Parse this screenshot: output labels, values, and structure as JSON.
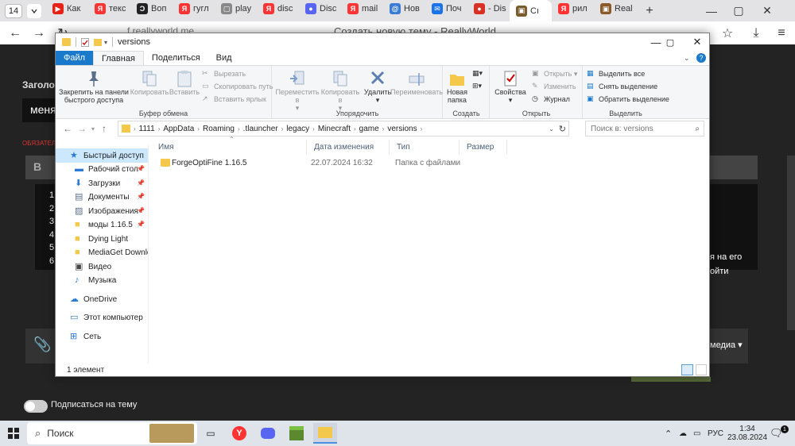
{
  "browser": {
    "tab_count": "14",
    "tabs": [
      {
        "label": "Как",
        "color": "#e62117",
        "glyph": "▶"
      },
      {
        "label": "текс",
        "color": "#f33",
        "glyph": "Я"
      },
      {
        "label": "Воп",
        "color": "#222",
        "glyph": "Ɔ"
      },
      {
        "label": "гугл",
        "color": "#f33",
        "glyph": "Я"
      },
      {
        "label": "play",
        "color": "#888",
        "glyph": "▢"
      },
      {
        "label": "disc",
        "color": "#f33",
        "glyph": "Я"
      },
      {
        "label": "Disc",
        "color": "#5865f2",
        "glyph": "●"
      },
      {
        "label": "mail",
        "color": "#f33",
        "glyph": "Я"
      },
      {
        "label": "Нов",
        "color": "#3a7bd5",
        "glyph": "@"
      },
      {
        "label": "Поч",
        "color": "#1a73e8",
        "glyph": "✉"
      },
      {
        "label": "- Dis",
        "color": "#d93025",
        "glyph": "●"
      },
      {
        "label": "Cı",
        "color": "#7a5c2e",
        "glyph": "▣"
      },
      {
        "label": "рил",
        "color": "#f33",
        "glyph": "Я"
      },
      {
        "label": "Real",
        "color": "#8b5a2b",
        "glyph": "▣"
      }
    ],
    "url": "f.reallyworld.me",
    "page_title": "Создать новую тему - ReallyWorld"
  },
  "webpage": {
    "heading_fragment": "Заголов",
    "input_fragment": "меня",
    "required_fragment": "ОБЯЗАТЕЛ",
    "toolbar_b": "B",
    "list_numbers": [
      "1.",
      "2.",
      "3.",
      "4.",
      "5.",
      "6."
    ],
    "right_text_1": "я на его",
    "right_text_2": "ойти",
    "media_label": "медиа",
    "subscribe_label": "Подписаться на тему"
  },
  "explorer": {
    "title": "versions",
    "ribbon_tabs": [
      "Файл",
      "Главная",
      "Поделиться",
      "Вид"
    ],
    "groups": {
      "clipboard": "Буфер обмена",
      "organize": "Упорядочить",
      "create": "Создать",
      "open": "Открыть",
      "select": "Выделить"
    },
    "buttons": {
      "pin": "Закрепить на панели быстрого доступа",
      "copy": "Копировать",
      "paste": "Вставить",
      "cut": "Вырезать",
      "copy_path": "Скопировать путь",
      "paste_shortcut": "Вставить ярлык",
      "move": "Переместить в",
      "copy_to": "Копировать в",
      "delete": "Удалить",
      "rename": "Переименовать",
      "new_folder": "Новая папка",
      "properties": "Свойства",
      "open": "Открыть",
      "edit": "Изменить",
      "history": "Журнал",
      "select_all": "Выделить все",
      "select_none": "Снять выделение",
      "invert": "Обратить выделение"
    },
    "path": [
      "1111",
      "AppData",
      "Roaming",
      ".tlauncher",
      "legacy",
      "Minecraft",
      "game",
      "versions"
    ],
    "search_placeholder": "Поиск в: versions",
    "nav": [
      {
        "label": "Быстрый доступ",
        "icon": "star-icon",
        "pinned": false
      },
      {
        "label": "Рабочий стол",
        "icon": "desktop-icon",
        "pinned": true
      },
      {
        "label": "Загрузки",
        "icon": "download-icon",
        "pinned": true
      },
      {
        "label": "Документы",
        "icon": "document-icon",
        "pinned": true
      },
      {
        "label": "Изображения",
        "icon": "image-icon",
        "pinned": true
      },
      {
        "label": "моды 1.16.5",
        "icon": "folder-icon",
        "pinned": true
      },
      {
        "label": "Dying Light",
        "icon": "folder-icon",
        "pinned": false
      },
      {
        "label": "MediaGet Downloads",
        "icon": "folder-icon",
        "pinned": false
      },
      {
        "label": "Видео",
        "icon": "video-icon",
        "pinned": false
      },
      {
        "label": "Музыка",
        "icon": "music-icon",
        "pinned": false
      },
      {
        "label": "OneDrive",
        "icon": "cloud-icon",
        "pinned": false
      },
      {
        "label": "Этот компьютер",
        "icon": "computer-icon",
        "pinned": false
      },
      {
        "label": "Сеть",
        "icon": "network-icon",
        "pinned": false
      }
    ],
    "columns": [
      "Имя",
      "Дата изменения",
      "Тип",
      "Размер"
    ],
    "files": [
      {
        "name": "ForgeOptiFine 1.16.5",
        "date": "22.07.2024 16:32",
        "type": "Папка с файлами",
        "size": ""
      }
    ],
    "status": "1 элемент"
  },
  "taskbar": {
    "search": "Поиск",
    "language": "РУС",
    "time": "1:34",
    "date": "23.08.2024",
    "notifications": "1"
  },
  "colors": {
    "accent": "#1979ca",
    "folder": "#f4c84a",
    "selection": "#cce8ff"
  }
}
